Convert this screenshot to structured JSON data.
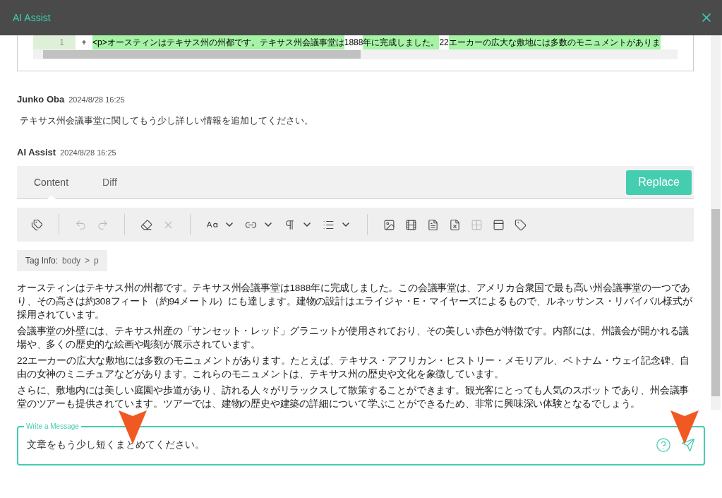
{
  "window": {
    "title": "AI Assist"
  },
  "diff": {
    "line_number": "1",
    "sign": "+",
    "segments": [
      {
        "text": "<p>オースティンはテキサス州の州都です。テキサス州会議事堂は",
        "highlighted": true
      },
      {
        "text": "1888",
        "highlighted": false
      },
      {
        "text": "年に完成しました。",
        "highlighted": true
      },
      {
        "text": "22",
        "highlighted": false
      },
      {
        "text": "エーカーの広大な敷地には多数のモニュメントがありま",
        "highlighted": true
      }
    ]
  },
  "messages": [
    {
      "author": "Junko Oba",
      "time": "2024/8/28 16:25",
      "kind": "user",
      "text": "テキサス州会議事堂に関してもう少し詳しい情報を追加してください。"
    },
    {
      "author": "AI Assist",
      "time": "2024/8/28 16:25",
      "kind": "assistant"
    }
  ],
  "tabs": [
    {
      "label": "Content",
      "selected": true
    },
    {
      "label": "Diff",
      "selected": false
    }
  ],
  "replace_button": "Replace",
  "toolbar": [
    {
      "kind": "tag",
      "disabled": false
    },
    {
      "kind": "sep"
    },
    {
      "kind": "undo",
      "disabled": true
    },
    {
      "kind": "redo",
      "disabled": true
    },
    {
      "kind": "sep"
    },
    {
      "kind": "eraser",
      "disabled": false
    },
    {
      "kind": "clear",
      "disabled": true
    },
    {
      "kind": "sep"
    },
    {
      "kind": "font",
      "disabled": false
    },
    {
      "kind": "link",
      "disabled": false
    },
    {
      "kind": "para",
      "disabled": false
    },
    {
      "kind": "list",
      "disabled": false
    },
    {
      "kind": "sep"
    },
    {
      "kind": "image",
      "disabled": false
    },
    {
      "kind": "video",
      "disabled": false
    },
    {
      "kind": "doc",
      "disabled": false
    },
    {
      "kind": "excel",
      "disabled": false
    },
    {
      "kind": "table",
      "disabled": true
    },
    {
      "kind": "layout",
      "disabled": false
    },
    {
      "kind": "tagcheck",
      "disabled": false
    }
  ],
  "tag_info": {
    "label": "Tag Info:",
    "path": [
      "body",
      ">",
      "p"
    ]
  },
  "paragraphs": [
    "オースティンはテキサス州の州都です。テキサス州会議事堂は1888年に完成しました。この会議事堂は、アメリカ合衆国で最も高い州会議事堂の一つであり、その高さは約308フィート（約94メートル）にも達します。建物の設計はエライジャ・E・マイヤーズによるもので、ルネッサンス・リバイバル様式が採用されています。",
    "会議事堂の外壁には、テキサス州産の「サンセット・レッド」グラニットが使用されており、その美しい赤色が特徴です。内部には、州議会が開かれる議場や、多くの歴史的な絵画や彫刻が展示されています。",
    "22エーカーの広大な敷地には多数のモニュメントがあります。たとえば、テキサス・アフリカン・ヒストリー・メモリアル、ベトナム・ウェイ記念碑、自由の女神のミニチュアなどがあります。これらのモニュメントは、テキサス州の歴史や文化を象徴しています。",
    "さらに、敷地内には美しい庭園や歩道があり、訪れる人々がリラックスして散策することができます。観光客にとっても人気のスポットであり、州会議事堂のツアーも提供されています。ツアーでは、建物の歴史や建築の詳細について学ぶことができるため、非常に興味深い体験となるでしょう。"
  ],
  "message_field": {
    "label": "Write a Message",
    "value": "文章をもう少し短くまとめてください。"
  }
}
